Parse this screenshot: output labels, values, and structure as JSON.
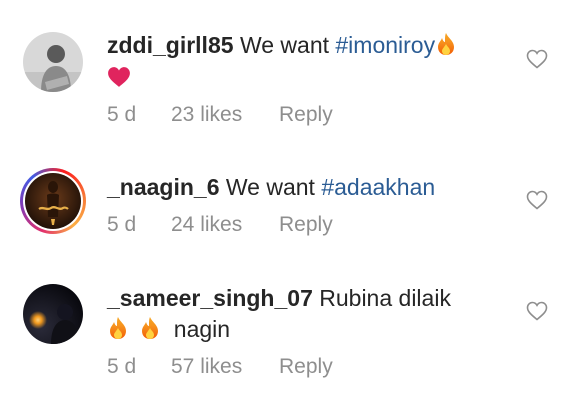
{
  "comments": [
    {
      "username": "zddi_girll85",
      "text_before": "We want ",
      "hashtag": "#imoniroy",
      "text_after": "",
      "emojis": [
        "fire",
        "red-heart"
      ],
      "time": "5 d",
      "likes": "23 likes",
      "reply": "Reply"
    },
    {
      "username": "_naagin_6",
      "text_before": "We want ",
      "hashtag": "#adaakhan",
      "text_after": "",
      "emojis": [],
      "time": "5 d",
      "likes": "24 likes",
      "reply": "Reply"
    },
    {
      "username": "_sameer_singh_07",
      "text_before": "Rubina dilaik",
      "hashtag": "",
      "text_after": "nagin",
      "emojis": [
        "fire",
        "fire"
      ],
      "time": "5 d",
      "likes": "57 likes",
      "reply": "Reply"
    }
  ],
  "icons": {
    "like": "heart-outline-icon",
    "fire": "fire-emoji-icon",
    "heart": "red-heart-emoji-icon"
  },
  "colors": {
    "text": "#262626",
    "meta": "#8e8e8e",
    "hashtag": "#2b5c94"
  }
}
